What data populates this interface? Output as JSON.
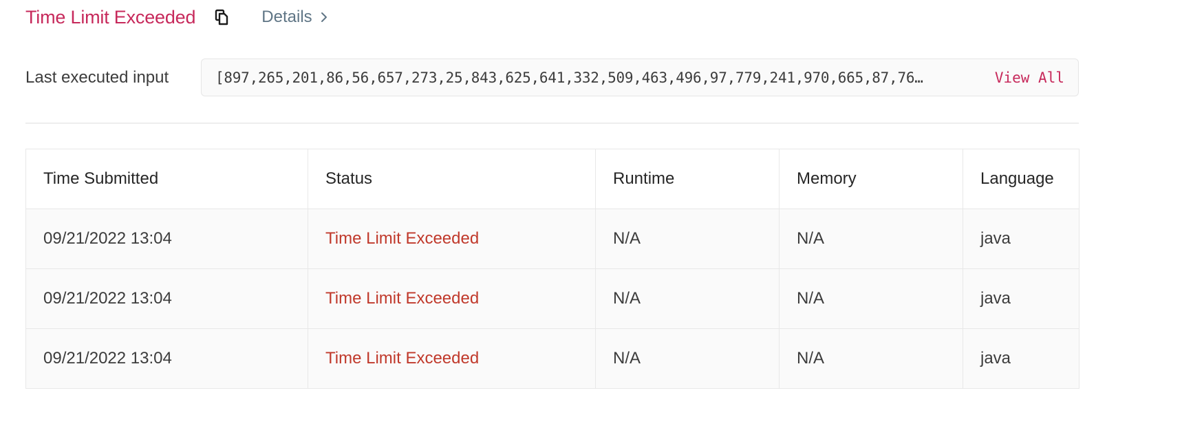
{
  "header": {
    "status": "Time Limit Exceeded",
    "details_label": "Details",
    "icons": {
      "copy": "copy-icon",
      "chevron": "chevron-right-icon"
    }
  },
  "last_input": {
    "label": "Last executed input",
    "value": "[897,265,201,86,56,657,273,25,843,625,641,332,509,463,496,97,779,241,970,665,87,76…",
    "view_all": "View All"
  },
  "table": {
    "headers": [
      "Time Submitted",
      "Status",
      "Runtime",
      "Memory",
      "Language"
    ],
    "rows": [
      {
        "time": "09/21/2022 13:04",
        "status": "Time Limit Exceeded",
        "runtime": "N/A",
        "memory": "N/A",
        "language": "java"
      },
      {
        "time": "09/21/2022 13:04",
        "status": "Time Limit Exceeded",
        "runtime": "N/A",
        "memory": "N/A",
        "language": "java"
      },
      {
        "time": "09/21/2022 13:04",
        "status": "Time Limit Exceeded",
        "runtime": "N/A",
        "memory": "N/A",
        "language": "java"
      }
    ]
  },
  "colors": {
    "accent": "#c7295b",
    "status_error": "#c0392b",
    "link_muted": "#5f7585"
  }
}
